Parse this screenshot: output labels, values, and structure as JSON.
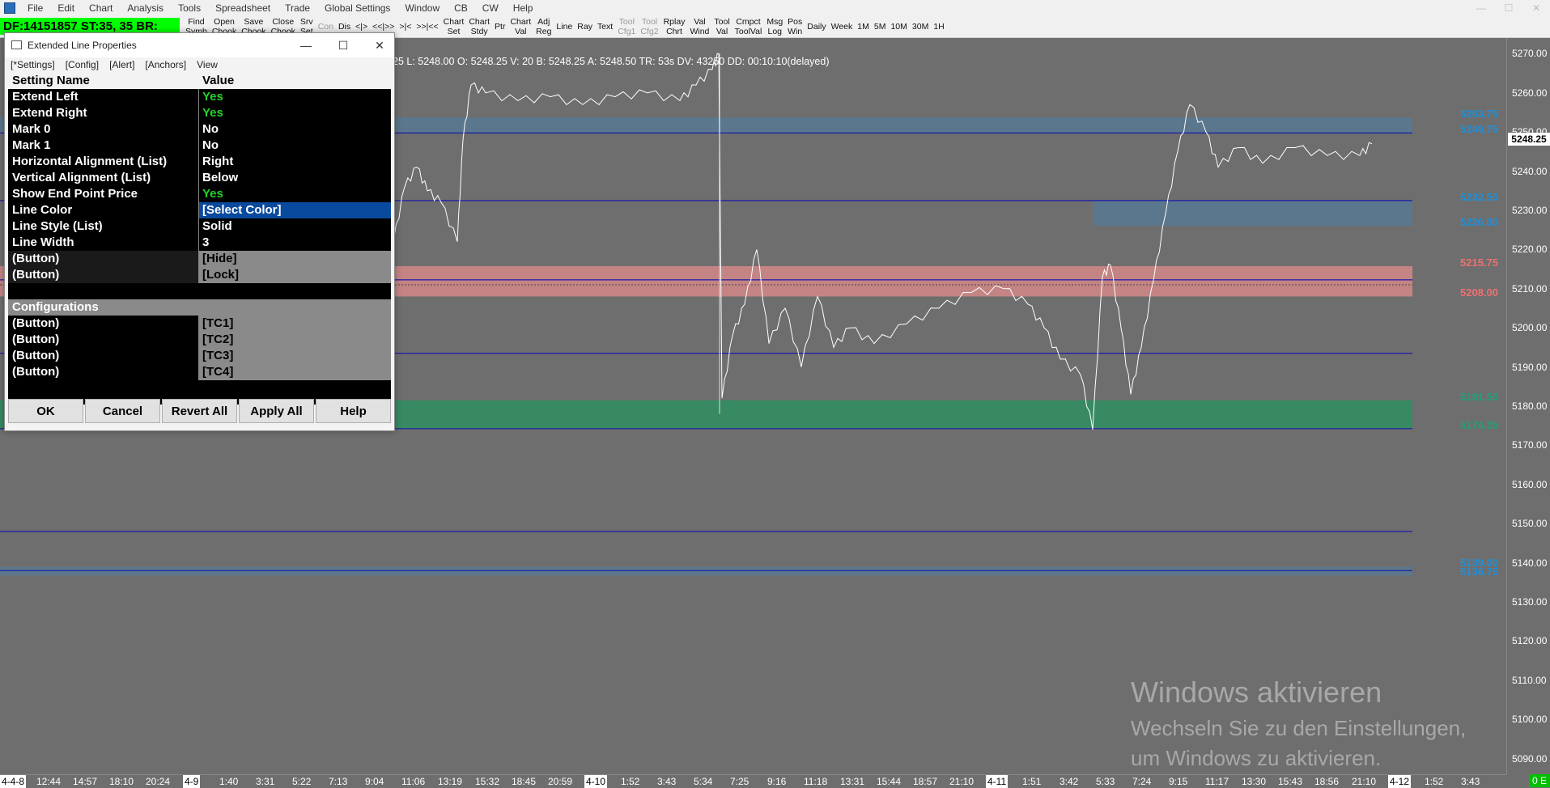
{
  "menubar": {
    "items": [
      "File",
      "Edit",
      "Chart",
      "Analysis",
      "Tools",
      "Spreadsheet",
      "Trade",
      "Global Settings",
      "Window",
      "CB",
      "CW",
      "Help"
    ],
    "window_controls": [
      "—",
      "☐",
      "✕"
    ]
  },
  "toolbar": {
    "status": "DF:14151857  ST:35, 35  BR:",
    "buttons": [
      {
        "label": "Find\nSymb"
      },
      {
        "label": "Open\nChook"
      },
      {
        "label": "Save\nChook"
      },
      {
        "label": "Close\nChook"
      },
      {
        "label": "Srv\nSet"
      },
      {
        "label": "Con",
        "dim": true
      },
      {
        "label": "Dis"
      },
      {
        "label": "<|>"
      },
      {
        "label": "<<|>>"
      },
      {
        "label": ">|<"
      },
      {
        "label": ">>|<<"
      },
      {
        "label": "Chart\nSet"
      },
      {
        "label": "Chart\nStdy"
      },
      {
        "label": "Ptr"
      },
      {
        "label": "Chart\nVal"
      },
      {
        "label": "Adj\nReg"
      },
      {
        "label": "Line"
      },
      {
        "label": "Ray"
      },
      {
        "label": "Text"
      },
      {
        "label": "Tool\nCfg1",
        "dim": true
      },
      {
        "label": "Tool\nCfg2",
        "dim": true
      },
      {
        "label": "Rplay\nChrt"
      },
      {
        "label": "Val\nWind"
      },
      {
        "label": "Tool\nVal"
      },
      {
        "label": "Cmpct\nToolVal"
      },
      {
        "label": "Msg\nLog"
      },
      {
        "label": "Pos\nWin"
      },
      {
        "label": "Daily"
      },
      {
        "label": "Week"
      },
      {
        "label": "1M"
      },
      {
        "label": "5M"
      },
      {
        "label": "10M"
      },
      {
        "label": "30M"
      },
      {
        "label": "1H"
      }
    ]
  },
  "chart": {
    "info_text": "25 L: 5248.00 O: 5248.25 V: 20 B: 5248.25 A: 5248.50 TR: 53s DV: 43250 DD: 00:10:10(delayed)",
    "current_price": "5248.25",
    "price_ticks": [
      "5270.00",
      "5260.00",
      "5250.00",
      "5240.00",
      "5230.00",
      "5220.00",
      "5210.00",
      "5200.00",
      "5190.00",
      "5180.00",
      "5170.00",
      "5160.00",
      "5150.00",
      "5140.00",
      "5130.00",
      "5120.00",
      "5110.00",
      "5100.00",
      "5090.00"
    ],
    "level_labels": [
      {
        "text": "5253.75",
        "color": "#1e90d8"
      },
      {
        "text": "5249.75",
        "color": "#1e90d8"
      },
      {
        "text": "5232.50",
        "color": "#1e90d8"
      },
      {
        "text": "5226.00",
        "color": "#1e90d8"
      },
      {
        "text": "5215.75",
        "color": "#f07070"
      },
      {
        "text": "5208.00",
        "color": "#f07070"
      },
      {
        "text": "5181.50",
        "color": "#1fa07a"
      },
      {
        "text": "5174.25",
        "color": "#1fa07a"
      },
      {
        "text": "5139.00",
        "color": "#1e90d8"
      },
      {
        "text": "5136.75",
        "color": "#1e90d8"
      }
    ],
    "time_ticks": [
      {
        "text": "4-4-8",
        "date": true
      },
      {
        "text": "12:44"
      },
      {
        "text": "14:57"
      },
      {
        "text": "18:10"
      },
      {
        "text": "20:24"
      },
      {
        "text": "4-9",
        "date": true
      },
      {
        "text": "1:40"
      },
      {
        "text": "3:31"
      },
      {
        "text": "5:22"
      },
      {
        "text": "7:13"
      },
      {
        "text": "9:04"
      },
      {
        "text": "11:06"
      },
      {
        "text": "13:19"
      },
      {
        "text": "15:32"
      },
      {
        "text": "18:45"
      },
      {
        "text": "20:59"
      },
      {
        "text": "4-10",
        "date": true
      },
      {
        "text": "1:52"
      },
      {
        "text": "3:43"
      },
      {
        "text": "5:34"
      },
      {
        "text": "7:25"
      },
      {
        "text": "9:16"
      },
      {
        "text": "11:18"
      },
      {
        "text": "13:31"
      },
      {
        "text": "15:44"
      },
      {
        "text": "18:57"
      },
      {
        "text": "21:10"
      },
      {
        "text": "4-11",
        "date": true
      },
      {
        "text": "1:51"
      },
      {
        "text": "3:42"
      },
      {
        "text": "5:33"
      },
      {
        "text": "7:24"
      },
      {
        "text": "9:15"
      },
      {
        "text": "11:17"
      },
      {
        "text": "13:30"
      },
      {
        "text": "15:43"
      },
      {
        "text": "18:56"
      },
      {
        "text": "21:10"
      },
      {
        "text": "4-12",
        "date": true
      },
      {
        "text": "1:52"
      },
      {
        "text": "3:43"
      }
    ],
    "corner_badge": "0 E",
    "colors": {
      "background": "#6e6e6e",
      "line_blue": "#1a1aa8",
      "band_blue": "#4a7fa8",
      "band_red": "#d98a8a",
      "band_green": "#2f8f62",
      "price_line": "#ffffff"
    }
  },
  "watermark": {
    "line1": "Windows aktivieren",
    "line2": "Wechseln Sie zu den Einstellungen,",
    "line3": "um Windows zu aktivieren."
  },
  "dialog": {
    "title": "Extended Line Properties",
    "title_controls": [
      "—",
      "☐",
      "✕"
    ],
    "tabs": [
      "[*Settings]",
      "[Config]",
      "[Alert]",
      "[Anchors]",
      "View"
    ],
    "header": {
      "name": "Setting Name",
      "value": "Value"
    },
    "rows": [
      {
        "name": "Extend Left",
        "value": "Yes",
        "style": "green"
      },
      {
        "name": "Extend Right",
        "value": "Yes",
        "style": "green"
      },
      {
        "name": "Mark 0",
        "value": "No",
        "style": ""
      },
      {
        "name": "Mark 1",
        "value": "No",
        "style": ""
      },
      {
        "name": "Horizontal Alignment (List)",
        "value": "Right",
        "style": ""
      },
      {
        "name": "Vertical Alignment (List)",
        "value": "Below",
        "style": ""
      },
      {
        "name": "Show End Point Price",
        "value": "Yes",
        "style": "green"
      },
      {
        "name": "Line Color",
        "value": "[Select Color]",
        "style": "sel"
      },
      {
        "name": "Line Style (List)",
        "value": "Solid",
        "style": ""
      },
      {
        "name": "Line Width",
        "value": "3",
        "style": ""
      }
    ],
    "button_rows": [
      {
        "name": " (Button)",
        "value": "[Hide]"
      },
      {
        "name": " (Button)",
        "value": "[Lock]"
      }
    ],
    "config_header": "Configurations",
    "config_rows": [
      {
        "name": " (Button)",
        "value": "[TC1]"
      },
      {
        "name": " (Button)",
        "value": "[TC2]"
      },
      {
        "name": " (Button)",
        "value": "[TC3]"
      },
      {
        "name": " (Button)",
        "value": "[TC4]"
      }
    ],
    "buttons": [
      "OK",
      "Cancel",
      "Revert All",
      "Apply All",
      "Help"
    ]
  }
}
